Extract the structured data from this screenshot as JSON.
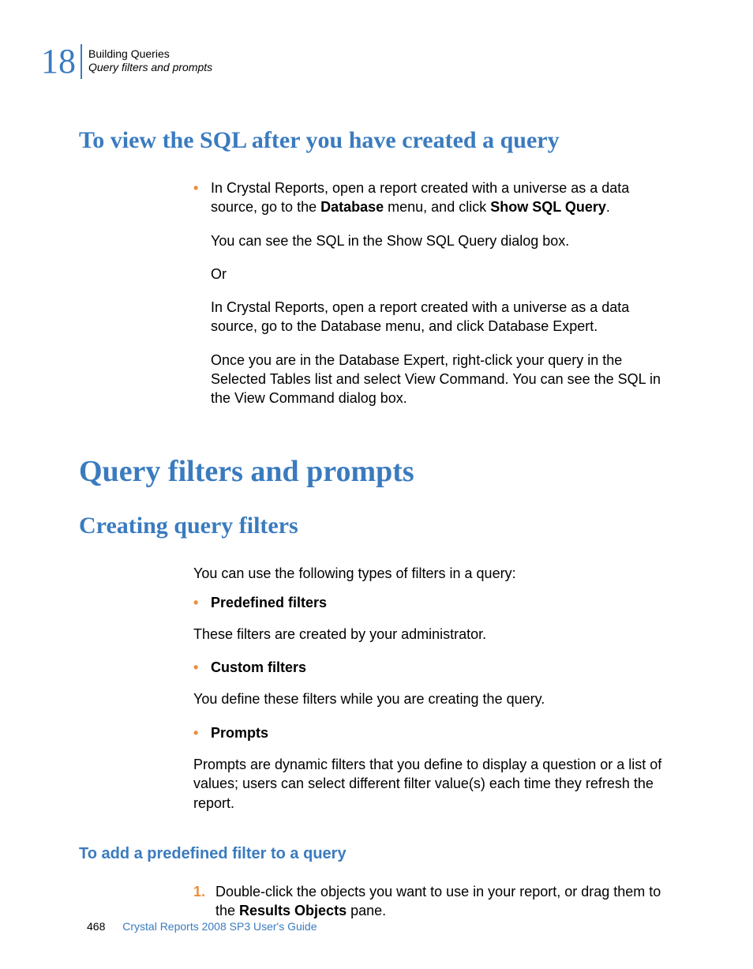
{
  "chapter": {
    "number": "18",
    "title": "Building Queries",
    "subtitle": "Query filters and prompts"
  },
  "sections": {
    "viewSql": {
      "heading": "To view the SQL after you have created a query",
      "bullet": {
        "p1a": "In Crystal Reports, open a report created with a universe as a data source, go to the ",
        "p1b": "Database",
        "p1c": " menu, and click ",
        "p1d": "Show SQL Query",
        "p1e": ".",
        "p2": "You can see the SQL in the Show SQL Query dialog box.",
        "p3": "Or",
        "p4": "In Crystal Reports, open a report created with a universe as a data source, go to the Database menu, and click Database Expert.",
        "p5": "Once you are in the Database Expert, right-click your query in the Selected Tables list and select View Command. You can see the SQL in the View Command dialog box."
      }
    },
    "queryFilters": {
      "heading": "Query filters and prompts"
    },
    "creatingFilters": {
      "heading": "Creating query filters",
      "intro": "You can use the following types of filters in a query:",
      "items": [
        {
          "title": "Predefined filters",
          "desc": "These filters are created by your administrator."
        },
        {
          "title": "Custom filters",
          "desc": "You define these filters while you are creating the query."
        },
        {
          "title": "Prompts",
          "desc": "Prompts are dynamic filters that you define to display a question or a list of values; users can select different filter value(s) each time they refresh the report."
        }
      ]
    },
    "addPredefined": {
      "heading": "To add a predefined filter to a query",
      "step1": {
        "num": "1.",
        "a": "Double-click the objects you want to use in your report, or drag them to the ",
        "b": "Results Objects",
        "c": " pane."
      }
    }
  },
  "footer": {
    "page": "468",
    "doc": "Crystal Reports 2008 SP3 User's Guide"
  }
}
